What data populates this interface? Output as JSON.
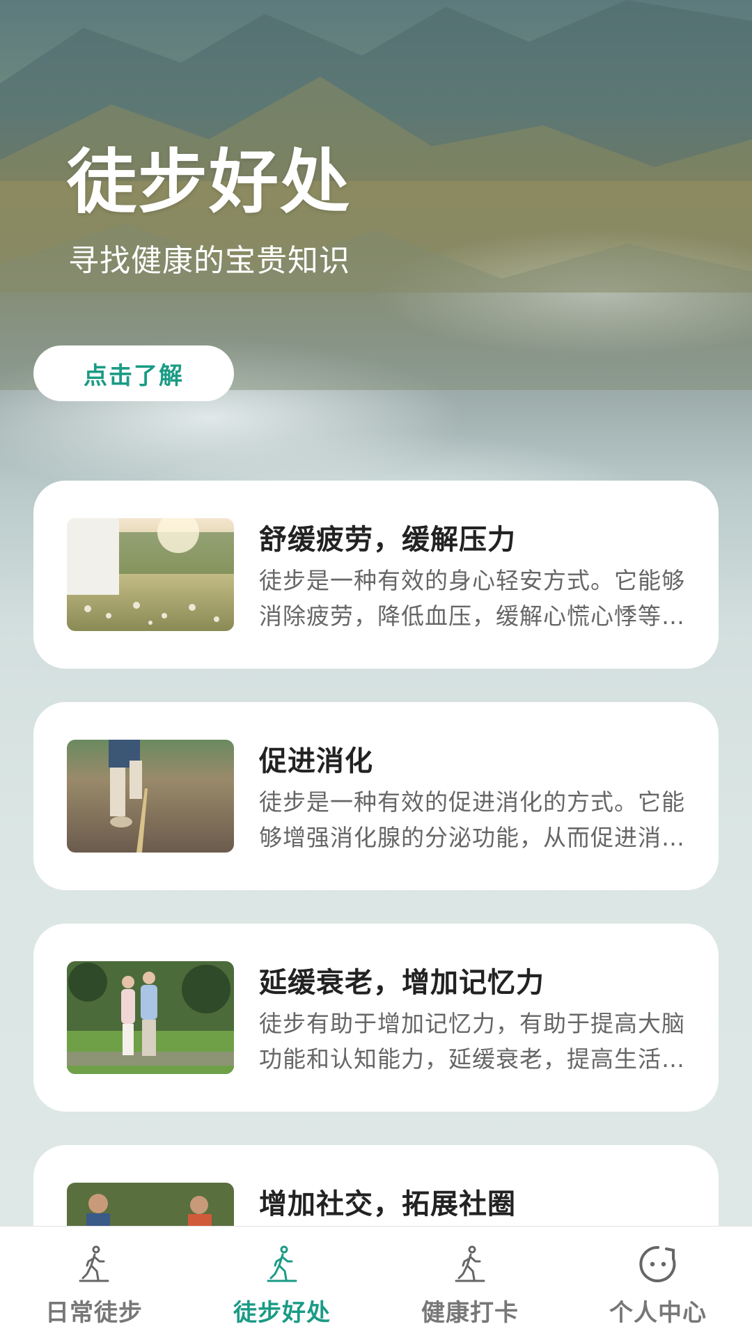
{
  "hero": {
    "title": "徒步好处",
    "subtitle": "寻找健康的宝贵知识",
    "button_label": "点击了解"
  },
  "cards": [
    {
      "title": "舒缓疲劳，缓解压力",
      "description": "徒步是一种有效的身心轻安方式。它能够消除疲劳，降低血压，缓解心慌心悸等症状。"
    },
    {
      "title": "促进消化",
      "description": "徒步是一种有效的促进消化的方式。它能够增强消化腺的分泌功能，从而促进消化吸收。"
    },
    {
      "title": "延缓衰老，增加记忆力",
      "description": "徒步有助于增加记忆力，有助于提高大脑功能和认知能力，延缓衰老，提高生活质量。"
    },
    {
      "title": "增加社交，拓展社圈",
      "description": ""
    }
  ],
  "tabbar": {
    "tabs": [
      {
        "label": "日常徒步",
        "icon": "walking-icon"
      },
      {
        "label": "徒步好处",
        "icon": "walking-icon"
      },
      {
        "label": "健康打卡",
        "icon": "walking-icon"
      },
      {
        "label": "个人中心",
        "icon": "face-icon"
      }
    ],
    "active_index": 1,
    "active_color": "#1a9b85",
    "inactive_color": "#777777"
  }
}
